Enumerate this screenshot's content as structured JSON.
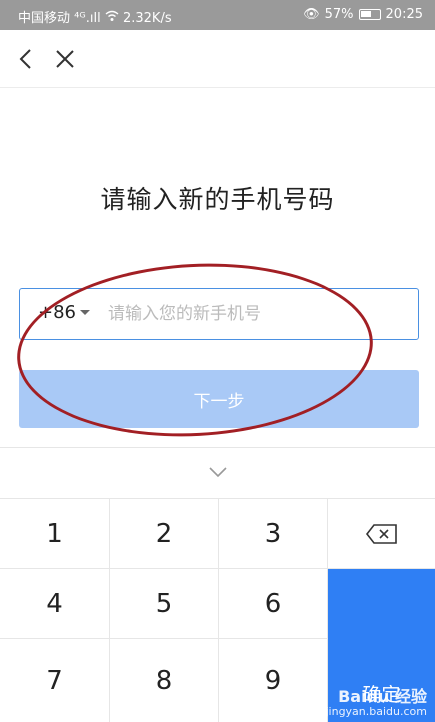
{
  "status_bar": {
    "carrier": "中国移动",
    "signal_text": "⁴ᴳ.ıll",
    "network_speed": "2.32K/s",
    "eye_icon": "👁",
    "battery": "57%",
    "time": "20:25"
  },
  "nav": {
    "back_icon": "chevron-left-icon",
    "close_icon": "close-icon"
  },
  "title": "请输入新的手机号码",
  "phone": {
    "country_code": "+86",
    "placeholder": "请输入您的新手机号",
    "value": ""
  },
  "next_button": "下一步",
  "keypad": {
    "keys": [
      "1",
      "2",
      "3",
      "4",
      "5",
      "6",
      "7",
      "8",
      "9"
    ],
    "confirm": "确定",
    "delete_icon": "backspace-icon"
  },
  "watermark": {
    "brand": "Baidu 经验",
    "url": "jingyan.baidu.com"
  },
  "colors": {
    "accent": "#2f7ff4",
    "disabled_button": "#a9c9f6",
    "annotation": "#a21f24"
  }
}
